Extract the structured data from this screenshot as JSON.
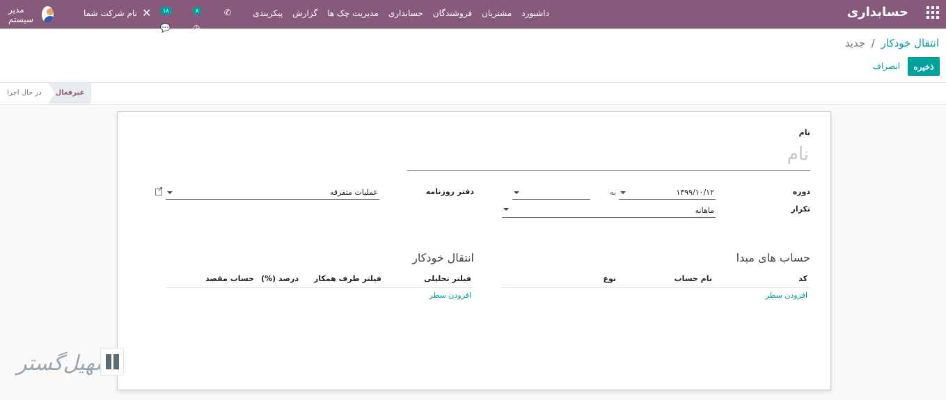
{
  "navbar": {
    "brand": "حسابداری",
    "menu": [
      "داشبورد",
      "مشتریان",
      "فروشندگان",
      "حسابداری",
      "مدیریت چک ها",
      "گزارش",
      "پیکربندی"
    ],
    "user_name": "مدیر سیستم",
    "company": "نام شرکت شما",
    "chat_count": "۱۸",
    "activity_count": "۸",
    "colors": {
      "navbar": "#875A7B",
      "accent": "#00A09D"
    }
  },
  "control": {
    "breadcrumb_root": "انتقال خودکار",
    "breadcrumb_sep": "/",
    "breadcrumb_current": "جدید",
    "save_label": "ذخیره",
    "discard_label": "انصراف"
  },
  "status": {
    "inactive": "غیرفعال",
    "running": "در حال اجرا"
  },
  "form": {
    "name_label": "نام",
    "name_placeholder": "نام",
    "period_label": "دوره",
    "period_from": "۱۳۹۹/۱۰/۱۲",
    "period_to_label": "به",
    "period_to": "",
    "journal_label": "دفتر روزنامه",
    "journal_value": "عملیات متفرقه",
    "frequency_label": "تکرار",
    "frequency_value": "ماهانه"
  },
  "source_accounts": {
    "title": "حساب های مبدا",
    "columns": [
      "کد",
      "نام حساب",
      "نوع"
    ],
    "add_line": "افزودن سطر"
  },
  "auto_transfer": {
    "title": "انتقال خودکار",
    "columns": [
      "فیلتر تحلیلی",
      "فیلتر طرف همکار",
      "درصد (%)",
      "حساب مقصد"
    ],
    "add_line": "افزودن سطر"
  },
  "watermark": {
    "text": "تسهیل‌گستر"
  }
}
